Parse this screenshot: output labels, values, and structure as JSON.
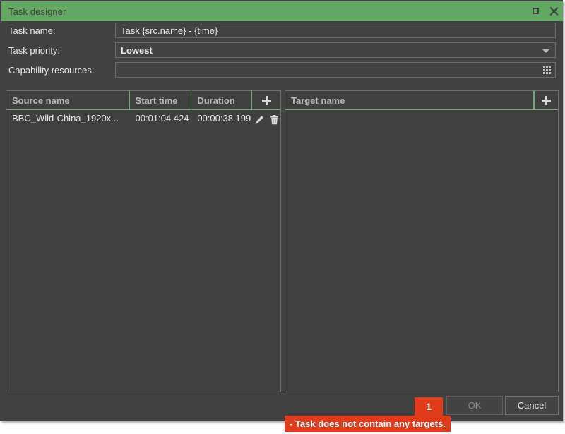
{
  "window": {
    "title": "Task designer",
    "accent_green": "#63a863",
    "background": "#414141",
    "error_red": "#e03c1c",
    "controls": {
      "maximize": "maximize-icon",
      "close": "close-icon"
    }
  },
  "form": {
    "task_name": {
      "label": "Task name:",
      "value": "Task {src.name} - {time}",
      "placeholder": ""
    },
    "task_priority": {
      "label": "Task priority:",
      "value": "Lowest",
      "options": [
        "Lowest"
      ],
      "icon": "chevron-down-icon"
    },
    "capability_resources": {
      "label": "Capability resources:",
      "value": "",
      "placeholder": "",
      "icon": "grid-dots-icon"
    }
  },
  "source_panel": {
    "columns": [
      "Source name",
      "Start time",
      "Duration"
    ],
    "add_label": "+",
    "rows": [
      {
        "source_name": "BBC_Wild-China_1920x...",
        "start_time": "00:01:04.424",
        "duration": "00:00:38.199",
        "edit_icon": "pencil-icon",
        "delete_icon": "trash-icon"
      }
    ]
  },
  "target_panel": {
    "columns": [
      "Target name"
    ],
    "add_label": "+",
    "rows": []
  },
  "footer": {
    "ok_label": "OK",
    "ok_enabled": false,
    "cancel_label": "Cancel"
  },
  "validation": {
    "badge_count": "1",
    "message": "- Task does not contain any targets."
  }
}
